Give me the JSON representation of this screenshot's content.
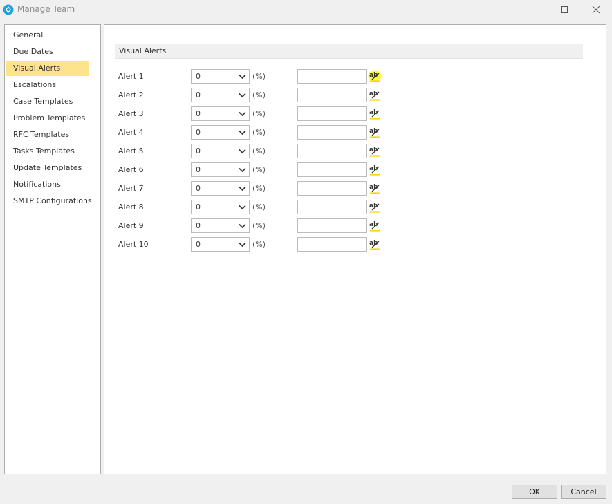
{
  "window": {
    "title": "Manage Team",
    "icon": "manage-team-app-icon",
    "controls": [
      "minimize-icon",
      "maximize-icon",
      "close-icon"
    ]
  },
  "sidebar": {
    "selected_index": 2,
    "selected_color": "#fde38b",
    "items": [
      {
        "label": "General"
      },
      {
        "label": "Due Dates"
      },
      {
        "label": "Visual Alerts"
      },
      {
        "label": "Escalations"
      },
      {
        "label": "Case Templates"
      },
      {
        "label": "Problem Templates"
      },
      {
        "label": "RFC Templates"
      },
      {
        "label": "Tasks Templates"
      },
      {
        "label": "Update Templates"
      },
      {
        "label": "Notifications"
      },
      {
        "label": "SMTP Configurations"
      }
    ]
  },
  "main": {
    "section_title": "Visual Alerts",
    "unit_label": "(%)",
    "edit_icon": "edit-text-icon",
    "highlight_color": "#ffff00",
    "alerts": [
      {
        "label": "Alert 1",
        "value": "0",
        "text": "",
        "highlighted": true
      },
      {
        "label": "Alert 2",
        "value": "0",
        "text": ""
      },
      {
        "label": "Alert 3",
        "value": "0",
        "text": ""
      },
      {
        "label": "Alert 4",
        "value": "0",
        "text": ""
      },
      {
        "label": "Alert 5",
        "value": "0",
        "text": ""
      },
      {
        "label": "Alert 6",
        "value": "0",
        "text": ""
      },
      {
        "label": "Alert 7",
        "value": "0",
        "text": ""
      },
      {
        "label": "Alert 8",
        "value": "0",
        "text": ""
      },
      {
        "label": "Alert 9",
        "value": "0",
        "text": ""
      },
      {
        "label": "Alert 10",
        "value": "0",
        "text": ""
      }
    ]
  },
  "footer": {
    "ok_label": "OK",
    "cancel_label": "Cancel"
  }
}
